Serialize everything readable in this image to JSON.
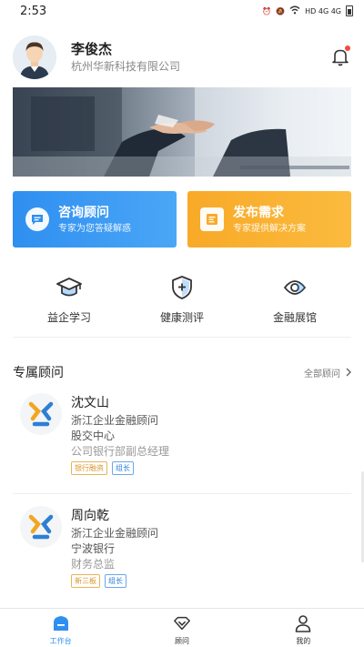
{
  "status_bar": {
    "time": "2:53",
    "network": "HD 4G 4G"
  },
  "profile": {
    "name": "李俊杰",
    "company": "杭州华新科技有限公司"
  },
  "action_cards": [
    {
      "title": "咨询顾问",
      "subtitle": "专家为您答疑解惑"
    },
    {
      "title": "发布需求",
      "subtitle": "专家提供解决方案"
    }
  ],
  "quick_links": [
    {
      "label": "益企学习",
      "icon": "graduation-cap-icon"
    },
    {
      "label": "健康测评",
      "icon": "shield-plus-icon"
    },
    {
      "label": "金融展馆",
      "icon": "eye-icon"
    }
  ],
  "section": {
    "title": "专属顾问",
    "more": "全部顾问"
  },
  "advisors": [
    {
      "name": "沈文山",
      "line1": "浙江企业金融顾问",
      "line2": "股交中心",
      "line3": "公司银行部副总经理",
      "tags": [
        "银行融资",
        "组长"
      ]
    },
    {
      "name": "周向乾",
      "line1": "浙江企业金融顾问",
      "line2": "宁波银行",
      "line3": "财务总监",
      "tags": [
        "新三板",
        "组长"
      ]
    }
  ],
  "tabs": [
    {
      "label": "工作台",
      "active": true
    },
    {
      "label": "顾问",
      "active": false
    },
    {
      "label": "我的",
      "active": false
    }
  ],
  "colors": {
    "accent": "#2f8ff0",
    "orange": "#f8a928",
    "tag_gold": "#d9962a",
    "notification": "#f04b3c"
  }
}
